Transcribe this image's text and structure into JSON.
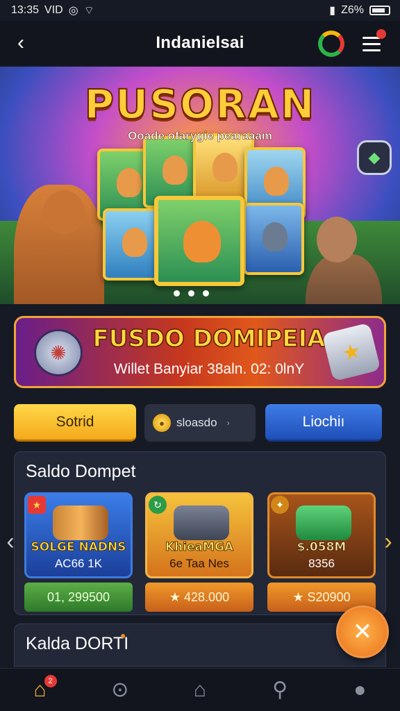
{
  "status_bar": {
    "time": "13:35",
    "carrier_label": "VID",
    "battery": "Z6%"
  },
  "header": {
    "title": "Indanielsai"
  },
  "banner": {
    "title": "PUSORAN",
    "subtitle": "Ooade ofarygie pearaaam",
    "active_slide": 1,
    "slide_count": 3
  },
  "promo": {
    "title": "FUSDO DOMIPEIA",
    "subtitle": "Willet Banyiar 38aln. 02: 0lnY"
  },
  "actions": {
    "yellow_button_label": "Sotrid",
    "coin_value": "sloasdo",
    "blue_button_label": "Liochiı"
  },
  "wallet": {
    "title": "Saldo Dompet",
    "cards": [
      {
        "name": "SOLGE NADNS",
        "value": "AC66 1K",
        "amount": "01, 299500"
      },
      {
        "name": "KhieaMGA",
        "value": "6e Taa Nes",
        "amount": "★ 428.000"
      },
      {
        "name": "$.058M",
        "value": "8356",
        "amount": "★ S20900"
      }
    ]
  },
  "second_panel": {
    "title": "Kalda DORTI"
  },
  "bottom_nav": {
    "home_badge": "2"
  },
  "colors": {
    "accent_yellow": "#f3a91a",
    "accent_blue": "#1f4fb8",
    "background": "#161a24",
    "panel": "#222838"
  },
  "icons": {
    "back": "arrow-left-icon",
    "menu": "hamburger-icon",
    "fab": "swords-icon",
    "nav": [
      "home-icon",
      "lock-icon",
      "house-icon",
      "search-icon",
      "user-icon"
    ]
  }
}
